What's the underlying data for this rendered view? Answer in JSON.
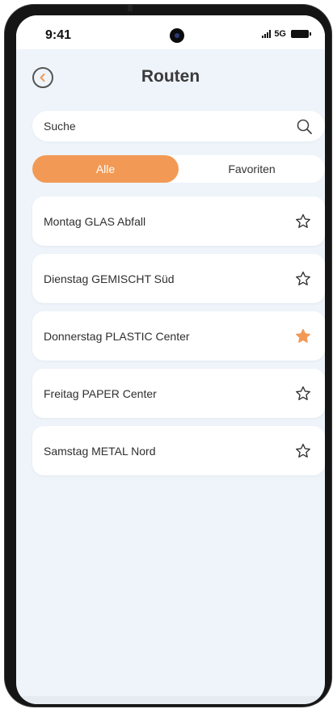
{
  "status_bar": {
    "time": "9:41",
    "network": "5G"
  },
  "header": {
    "title": "Routen"
  },
  "search": {
    "placeholder": "Suche"
  },
  "filter_tabs": [
    {
      "label": "Alle",
      "active": true
    },
    {
      "label": "Favoriten",
      "active": false
    }
  ],
  "routes": [
    {
      "label": "Montag GLAS Abfall",
      "favorite": false
    },
    {
      "label": "Dienstag GEMISCHT Süd",
      "favorite": false
    },
    {
      "label": "Donnerstag PLASTIC Center",
      "favorite": true
    },
    {
      "label": "Freitag PAPER Center",
      "favorite": false
    },
    {
      "label": "Samstag METAL Nord",
      "favorite": false
    }
  ],
  "colors": {
    "accent": "#f29a55",
    "background": "#eef4fa",
    "card": "#ffffff"
  },
  "icons": {
    "back": "chevron-left-circle-icon",
    "search": "search-icon",
    "favorite": "star-icon"
  }
}
